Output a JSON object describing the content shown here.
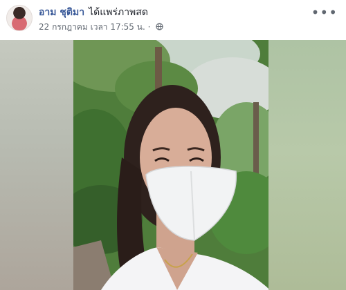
{
  "post": {
    "author": "อาม ชุติมา",
    "action": "ได้แพร่ภาพสด",
    "timestamp": "22 กรกฎาคม เวลา 17:55 น.",
    "separator": "·",
    "privacy_icon": "globe-icon",
    "more_icon": "more-options-icon",
    "more_glyph": "•••"
  },
  "colors": {
    "author_link": "#385898",
    "meta_text": "#606770",
    "foliage": "#4e7d3a",
    "mask": "#f2f3f4",
    "shirt": "#f4f4f6",
    "hair": "#2e211d"
  }
}
